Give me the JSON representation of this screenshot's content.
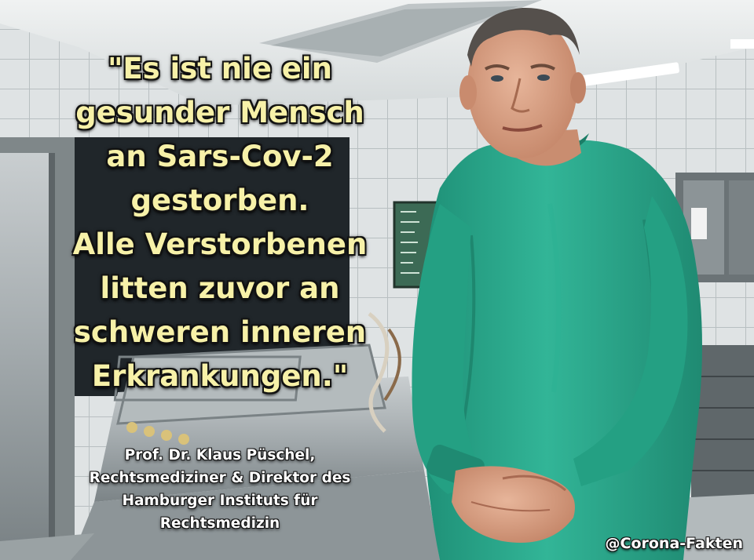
{
  "quote": {
    "lines": [
      "\"Es ist nie ein",
      "gesunder Mensch",
      "an Sars-Cov-2",
      "gestorben.",
      "Alle Verstorbenen",
      "litten zuvor an",
      "schweren inneren",
      "Erkrankungen.\""
    ]
  },
  "attribution": {
    "lines": [
      "Prof. Dr. Klaus Püschel,",
      "Rechtsmediziner & Direktor des",
      "Hamburger Instituts für",
      "Rechtsmedizin"
    ]
  },
  "watermark": "@Corona-Fakten",
  "colors": {
    "quote_text": "#f7f1a8",
    "scrubs": "#2aa98c",
    "tiles": "#dfe3e4"
  }
}
